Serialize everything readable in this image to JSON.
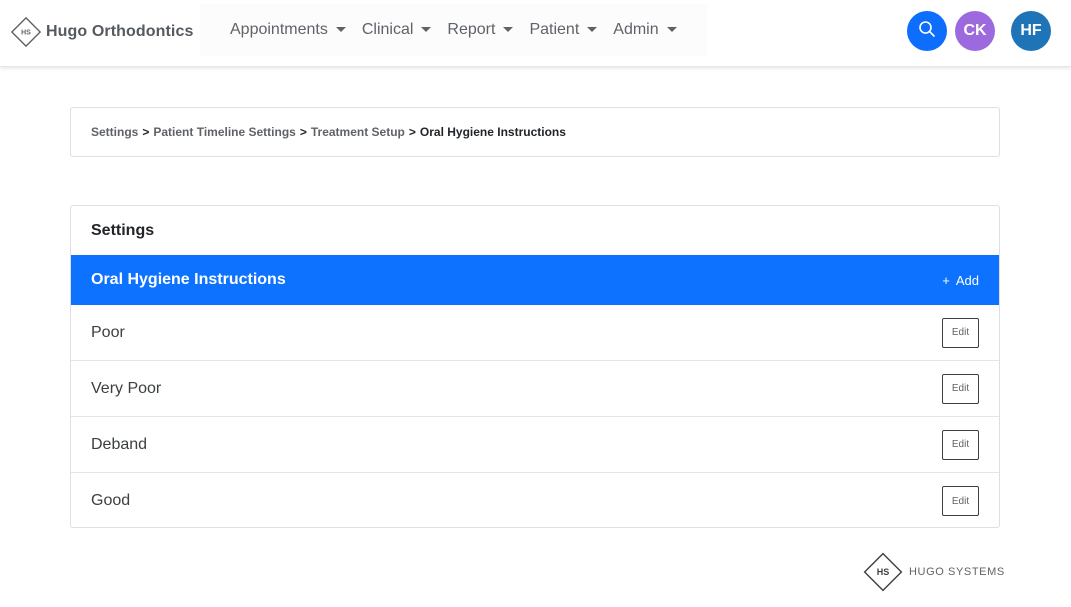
{
  "app": {
    "brand_name": "Hugo Orthodontics",
    "brand_logo_text": "HS"
  },
  "nav": {
    "items": [
      {
        "label": "Appointments",
        "icon": "chevron-down-icon"
      },
      {
        "label": "Clinical",
        "icon": "chevron-down-icon"
      },
      {
        "label": "Report",
        "icon": "chevron-down-icon"
      },
      {
        "label": "Patient",
        "icon": "chevron-down-icon"
      },
      {
        "label": "Admin",
        "icon": "chevron-down-icon"
      }
    ],
    "search_icon": "search-icon",
    "avatars": [
      {
        "initials": "CK",
        "color": "#9c6ade"
      },
      {
        "initials": "HF",
        "color": "#1f74b8"
      }
    ],
    "search_color": "#0d6efd"
  },
  "breadcrumb": {
    "items": [
      "Settings",
      "Patient Timeline Settings",
      "Treatment Setup"
    ],
    "current": "Oral Hygiene Instructions",
    "separator": ">"
  },
  "settings": {
    "title": "Settings",
    "section_title": "Oral Hygiene Instructions",
    "section_color": "#0d72ff",
    "add_label": "Add",
    "add_icon": "plus-icon",
    "edit_label": "Edit",
    "items": [
      {
        "label": "Poor"
      },
      {
        "label": "Very Poor"
      },
      {
        "label": "Deband"
      },
      {
        "label": "Good"
      }
    ]
  },
  "footer": {
    "logo_text": "HS",
    "company": "HUGO SYSTEMS"
  }
}
